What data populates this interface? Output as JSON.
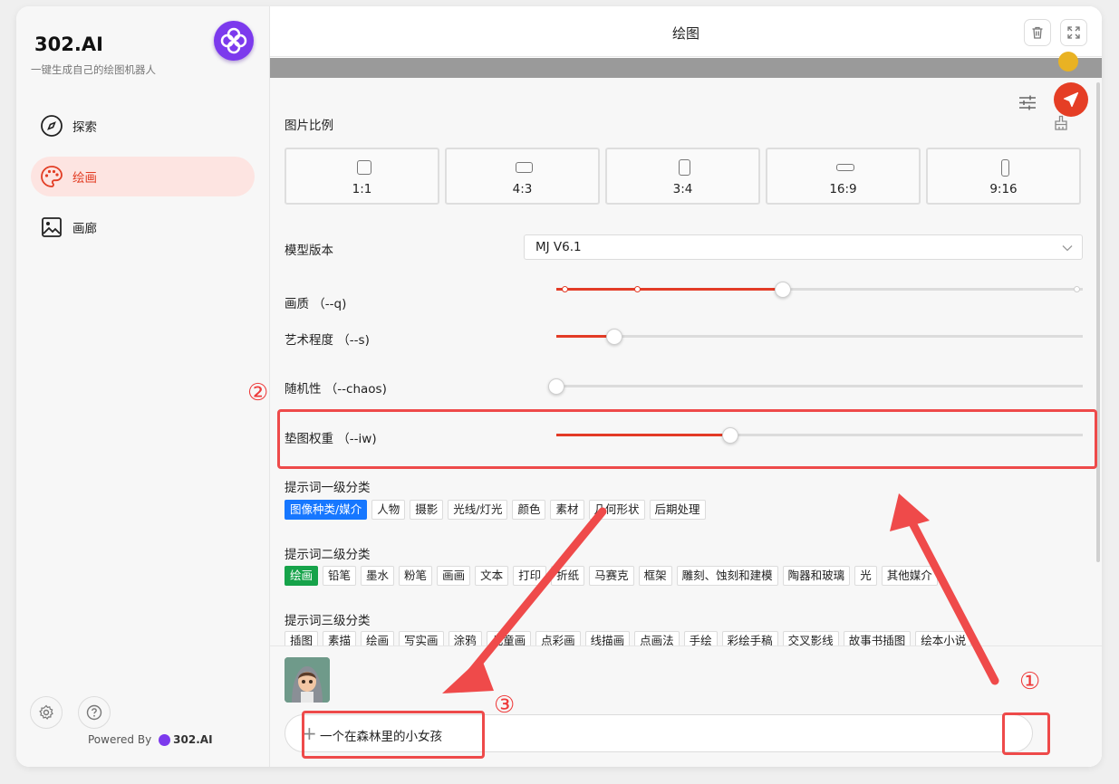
{
  "sidebar": {
    "brand_title": "302.AI",
    "brand_subtitle": "一键生成自己的绘图机器人",
    "items": [
      {
        "label": "探索",
        "icon": "compass-icon"
      },
      {
        "label": "绘画",
        "icon": "palette-icon",
        "active": true
      },
      {
        "label": "画廊",
        "icon": "image-icon"
      }
    ],
    "footer": {
      "powered_label": "Powered By",
      "powered_brand": "302.AI"
    }
  },
  "header": {
    "title": "绘图"
  },
  "settings": {
    "ratio_label": "图片比例",
    "ratios": [
      "1:1",
      "4:3",
      "3:4",
      "16:9",
      "9:16"
    ],
    "model_label": "模型版本",
    "model_value": "MJ V6.1",
    "quality_label": "画质 （--q)",
    "quality_level": 0.43,
    "stylize_label": "艺术程度 （--s)",
    "stylize_level": 0.11,
    "chaos_label": "随机性 （--chaos)",
    "chaos_level": 0.0,
    "iw_label": "垫图权重 （--iw)",
    "iw_level": 0.33,
    "cat1_label": "提示词一级分类",
    "cat1_tags": [
      "图像种类/媒介",
      "人物",
      "摄影",
      "光线/灯光",
      "颜色",
      "素材",
      "几何形状",
      "后期处理"
    ],
    "cat2_label": "提示词二级分类",
    "cat2_tags": [
      "绘画",
      "铅笔",
      "墨水",
      "粉笔",
      "画画",
      "文本",
      "打印",
      "折纸",
      "马赛克",
      "框架",
      "雕刻、蚀刻和建模",
      "陶器和玻璃",
      "光",
      "其他媒介"
    ],
    "cat3_label": "提示词三级分类",
    "cat3_tags": [
      "插图",
      "素描",
      "绘画",
      "写实画",
      "涂鸦",
      "儿童画",
      "点彩画",
      "线描画",
      "点画法",
      "手绘",
      "彩绘手稿",
      "交叉影线",
      "故事书插图",
      "绘本小说"
    ]
  },
  "input": {
    "value": "一个在森林里的小女孩"
  },
  "annotations": {
    "one": "①",
    "two": "②",
    "three": "③"
  },
  "colors": {
    "accent": "#e33b26",
    "brand": "#7c3aed",
    "annotation": "#ee4a4a"
  }
}
